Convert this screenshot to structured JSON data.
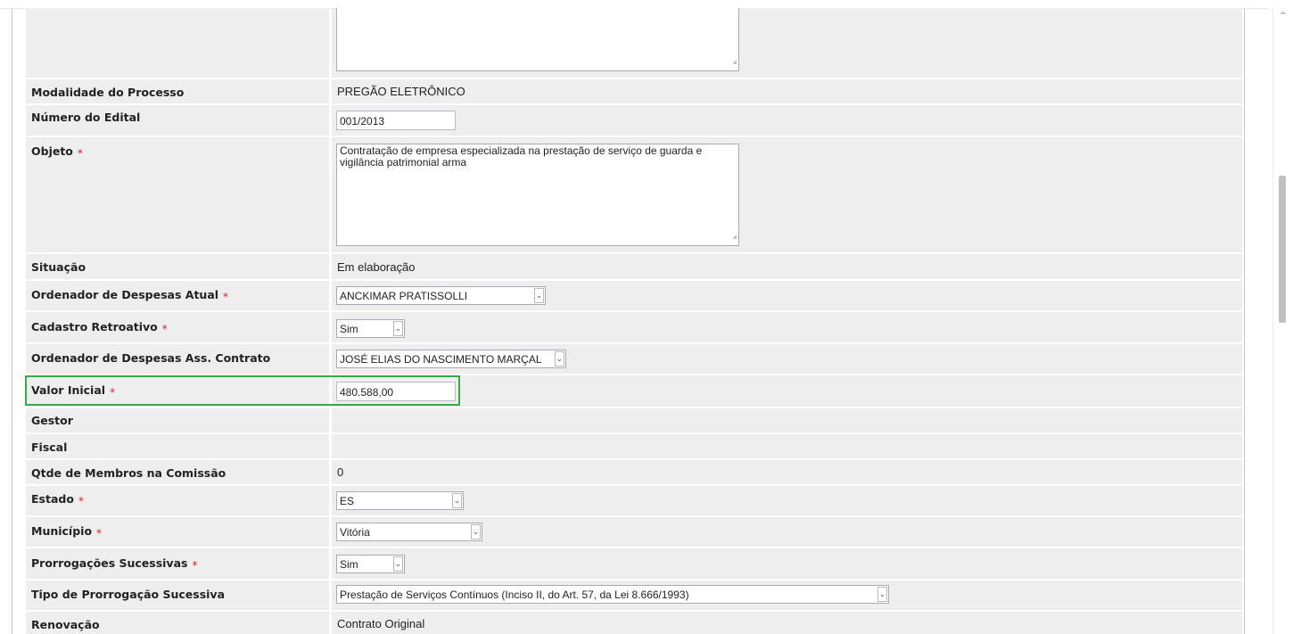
{
  "form": {
    "modalidade_label": "Modalidade do Processo",
    "modalidade_value": "PREGÃO ELETRÔNICO",
    "numero_edital_label": "Número do Edital",
    "numero_edital_value": "001/2013",
    "objeto_label": "Objeto",
    "objeto_value": "Contratação de empresa especializada na prestação de serviço de guarda e vigilância patrimonial arma",
    "situacao_label": "Situação",
    "situacao_value": "Em elaboração",
    "ordenador_atual_label": "Ordenador de Despesas Atual",
    "ordenador_atual_value": "ANCKIMAR PRATISSOLLI",
    "cadastro_retroativo_label": "Cadastro Retroativo",
    "cadastro_retroativo_value": "Sim",
    "ordenador_ass_label": "Ordenador de Despesas Ass. Contrato",
    "ordenador_ass_value": "JOSÉ ELIAS DO NASCIMENTO MARÇAL",
    "valor_inicial_label": "Valor Inicial",
    "valor_inicial_value": "480.588,00",
    "gestor_label": "Gestor",
    "fiscal_label": "Fiscal",
    "qtde_membros_label": "Qtde de Membros na Comissão",
    "qtde_membros_value": "0",
    "estado_label": "Estado",
    "estado_value": "ES",
    "municipio_label": "Município",
    "municipio_value": "Vitória",
    "prorrogacoes_label": "Prorrogações Sucessivas",
    "prorrogacoes_value": "Sim",
    "tipo_prorrogacao_label": "Tipo de Prorrogação Sucessiva",
    "tipo_prorrogacao_value": "Prestação de Serviços Contínuos (Inciso II, do Art. 57, da Lei 8.666/1993)",
    "renovacao_label": "Renovação",
    "renovacao_value": "Contrato Original",
    "required_marker": "*"
  },
  "icons": {
    "dropdown": "chevron-down-icon",
    "scroll_up": "scroll-up-arrow-icon",
    "resize": "resize-grip-icon"
  },
  "colors": {
    "row_bg": "#eeeeee",
    "required": "#d81f1f",
    "highlight": "#3aa64a"
  }
}
